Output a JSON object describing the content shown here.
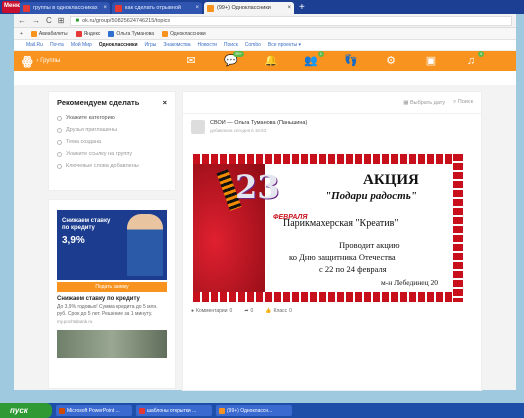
{
  "browser": {
    "menu_label": "Меню",
    "tabs": [
      {
        "label": "группы в одноклассниках",
        "favicon": "yandex-icon",
        "color": "#e53935",
        "active": false
      },
      {
        "label": "как сделать отрывной",
        "favicon": "yandex-icon",
        "color": "#e53935",
        "active": false
      },
      {
        "label": "(99+) Одноклассники",
        "favicon": "ok-icon",
        "color": "#f7931e",
        "active": true
      }
    ],
    "new_tab": "+",
    "url": "ok.ru/group/50825624746215/topics",
    "bookmarks": [
      {
        "label": "Авиабилеты",
        "icon": "plane-icon",
        "color": "#f7931e"
      },
      {
        "label": "Яндекс",
        "icon": "yandex-icon",
        "color": "#e53935"
      },
      {
        "label": "Ольга Туманова",
        "icon": "profile-icon",
        "color": "#2f6fd1"
      },
      {
        "label": "Одноклассники",
        "icon": "ok-icon",
        "color": "#f7931e"
      }
    ]
  },
  "mailru_bar": {
    "items": [
      "Mail.Ru",
      "Почта",
      "Мой Мир",
      "Одноклассники",
      "Игры",
      "Знакомства",
      "Новости",
      "Поиск",
      "Combo",
      "Все проекты ▾"
    ],
    "current": "Одноклассники"
  },
  "ok_bar": {
    "back_label": "Группы",
    "badges": {
      "messages": "99+",
      "friends": "1",
      "music": "4"
    },
    "accent": "#f7931e"
  },
  "recommend": {
    "title": "Рекомендуем сделать",
    "items": [
      "Укажите категорию",
      "Друзья приглашены",
      "Тема создана",
      "Укажите ссылку на группу",
      "Ключевые слова добавлены"
    ]
  },
  "ad": {
    "banner_line1": "Снижаем ставку по кредиту",
    "banner_rate": "3,9%",
    "button": "Подать заявку",
    "title": "Снижаем ставку по кредиту",
    "desc": "До 3,9% годовых! Сумма кредита до 5 млн. руб. Срок до 5 лет. Решение за 1 минуту.",
    "source": "my.pochtabank.ru"
  },
  "feed": {
    "choose_date": "Выбрать дату",
    "search": "Поиск",
    "author": "СВОИ — Ольга Туманова (Паньшина)",
    "time": "добавлена сегодня в 16:53"
  },
  "poster": {
    "number": "23",
    "february": "ФЕВРАЛЯ",
    "action": "АКЦИЯ",
    "gift": "\"Подари радость\"",
    "salon": "Парикмахерская \"Креатив\"",
    "line1": "Проводит акцию",
    "line2": "ко Дню защитника Отечества",
    "line3": "с 22 по 24 февраля",
    "address": "м-н Лебединец 20"
  },
  "actions": {
    "comments": "Комментарии",
    "comments_count": "0",
    "shares_count": "0",
    "likes": "Класс",
    "likes_count": "0"
  },
  "taskbar": {
    "start": "пуск",
    "tasks": [
      {
        "label": "Microsoft PowerPoint ...",
        "icon": "powerpoint-icon",
        "color": "#d04a02"
      },
      {
        "label": "шаблоны открытки ...",
        "icon": "yandex-icon",
        "color": "#e53935"
      },
      {
        "label": "(99+) Одноклассн...",
        "icon": "ok-icon",
        "color": "#f7931e"
      }
    ]
  }
}
